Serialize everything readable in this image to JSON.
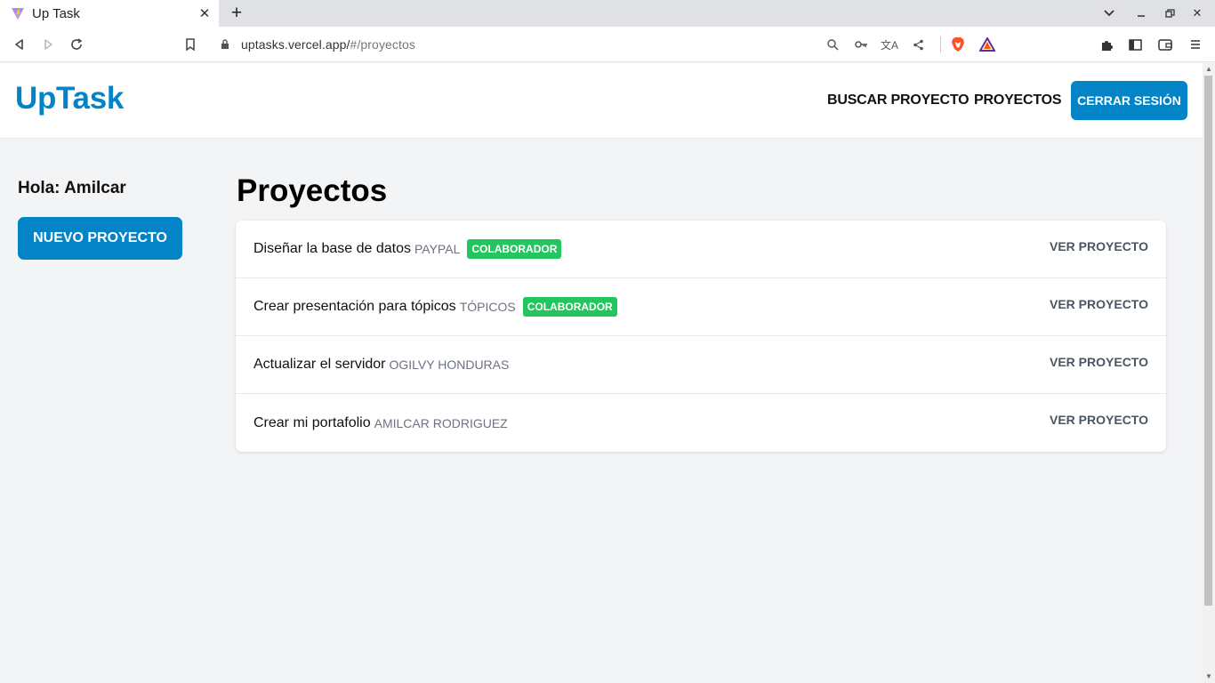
{
  "browser": {
    "tab_title": "Up Task",
    "url_host": "uptasks.vercel.app/",
    "url_path": "#/proyectos"
  },
  "header": {
    "logo": "UpTask",
    "nav": [
      "BUSCAR PROYECTO",
      "PROYECTOS"
    ],
    "logout_label": "CERRAR SESIÓN"
  },
  "sidebar": {
    "greeting": "Hola: Amilcar",
    "new_project_label": "NUEVO PROYECTO"
  },
  "main": {
    "title": "Proyectos",
    "view_label": "VER PROYECTO",
    "projects": [
      {
        "name": "Diseñar la base de datos",
        "client": "PAYPAL",
        "badge": "COLABORADOR"
      },
      {
        "name": "Crear presentación para tópicos",
        "client": "TÓPICOS",
        "badge": "COLABORADOR"
      },
      {
        "name": "Actualizar el servidor",
        "client": "OGILVY HONDURAS",
        "badge": ""
      },
      {
        "name": "Crear mi portafolio",
        "client": "AMILCAR RODRIGUEZ",
        "badge": ""
      }
    ]
  },
  "colors": {
    "accent": "#0284c7",
    "badge": "#22c55e",
    "background": "#f3f4f6"
  }
}
